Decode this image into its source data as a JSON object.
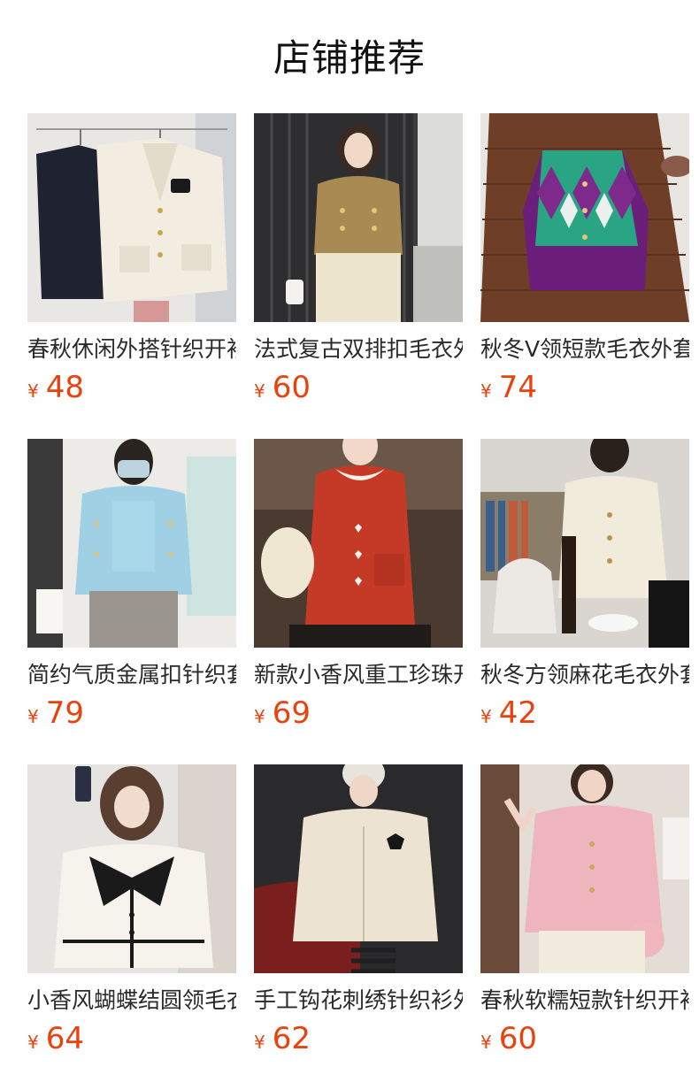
{
  "page": {
    "title": "店铺推荐"
  },
  "currency_symbol": "¥",
  "accent_color": "#e8430e",
  "products": [
    {
      "name": "春秋休闲外搭针织开衫",
      "price": "48",
      "image": "cream-and-navy-cardigans-on-hangers"
    },
    {
      "name": "法式复古双排扣毛衣外套",
      "price": "60",
      "image": "woman-in-camel-double-breasted-cardigan"
    },
    {
      "name": "秋冬V领短款毛衣外套",
      "price": "74",
      "image": "purple-green-argyle-cardigan-on-table"
    },
    {
      "name": "简约气质金属扣针织套装",
      "price": "79",
      "image": "woman-in-light-blue-knit-set"
    },
    {
      "name": "新款小香风重工珍珠开衫",
      "price": "69",
      "image": "woman-in-red-cardigan-with-lace-collar"
    },
    {
      "name": "秋冬方领麻花毛衣外套",
      "price": "42",
      "image": "woman-in-cream-cable-knit-cardigan"
    },
    {
      "name": "小香风蝴蝶结圆领毛衣",
      "price": "64",
      "image": "woman-in-white-cardigan-with-black-bow"
    },
    {
      "name": "手工钩花刺绣针织衫外套",
      "price": "62",
      "image": "woman-in-cream-embroidered-cardigan"
    },
    {
      "name": "春秋软糯短款针织开衫",
      "price": "60",
      "image": "woman-in-pink-fluffy-cardigan"
    }
  ]
}
